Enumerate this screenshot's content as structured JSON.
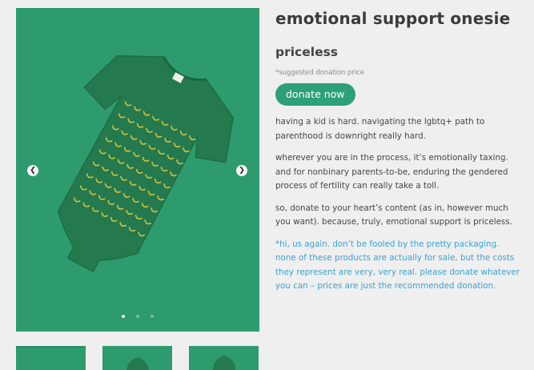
{
  "product": {
    "title": "emotional support onesie",
    "price": "priceless",
    "price_note": "*suggested donation price",
    "donate_label": "donate now"
  },
  "description": [
    "having a kid is hard. navigating the lgbtq+ path to parenthood is downright really hard.",
    "wherever you are in the process, it’s emotionally taxing. and for nonbinary parents-to-be, enduring the gendered process of fertility can really take a toll.",
    "so, donate to your heart’s content (as in, however much you want). because, truly, emotional support is priceless."
  ],
  "disclaimer": "*hi, us again. don’t be fooled by the pretty packaging. none of these products are actually for sale, but the costs they represent are very, very real. please donate whatever you can – prices are just the recommended donation.",
  "gallery": {
    "active_slide": 1,
    "slide_count": 3,
    "prev_icon": "chevron-left-icon",
    "next_icon": "chevron-right-icon",
    "thumbnail_count": 3
  },
  "colors": {
    "background": "#efefef",
    "photo_background": "#2e9b6f",
    "onesie": "#247a4e",
    "pattern": "#d8c23a",
    "accent_button": "#2da07a",
    "disclaimer_text": "#3aa2cf"
  }
}
